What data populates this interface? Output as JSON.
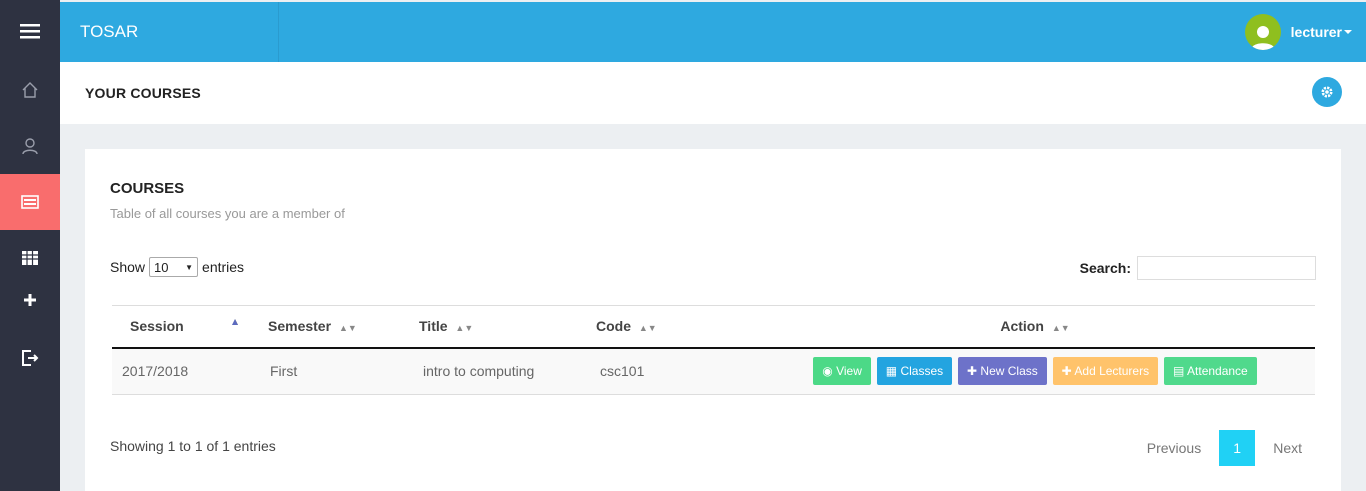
{
  "app": {
    "brand": "TOSAR"
  },
  "user": {
    "name": "lecturer"
  },
  "sidebar": {
    "items": [
      {
        "icon": "home-icon"
      },
      {
        "icon": "user-icon"
      },
      {
        "icon": "courses-icon",
        "active": true
      },
      {
        "icon": "table-icon"
      },
      {
        "icon": "plus-icon"
      },
      {
        "icon": "logout-icon"
      }
    ]
  },
  "page": {
    "title": "YOUR COURSES"
  },
  "card": {
    "title": "COURSES",
    "subtitle": "Table of all courses you are a member of"
  },
  "controls": {
    "show_label": "Show",
    "entries_label": "entries",
    "page_size": "10",
    "search_label": "Search:",
    "search_value": ""
  },
  "table": {
    "columns": [
      "Session",
      "Semester",
      "Title",
      "Code",
      "Action"
    ],
    "rows": [
      {
        "session": "2017/2018",
        "semester": "First",
        "title": "intro to computing",
        "code": "csc101"
      }
    ],
    "actions": {
      "view": "View",
      "classes": "Classes",
      "new_class": "New Class",
      "add_lecturers": "Add Lecturers",
      "attendance": "Attendance"
    }
  },
  "footer": {
    "info": "Showing 1 to 1 of 1 entries",
    "previous": "Previous",
    "current_page": "1",
    "next": "Next"
  },
  "colors": {
    "topbar": "#2ea9e0",
    "sidebar": "#2e3241",
    "active": "#f96d6d"
  }
}
